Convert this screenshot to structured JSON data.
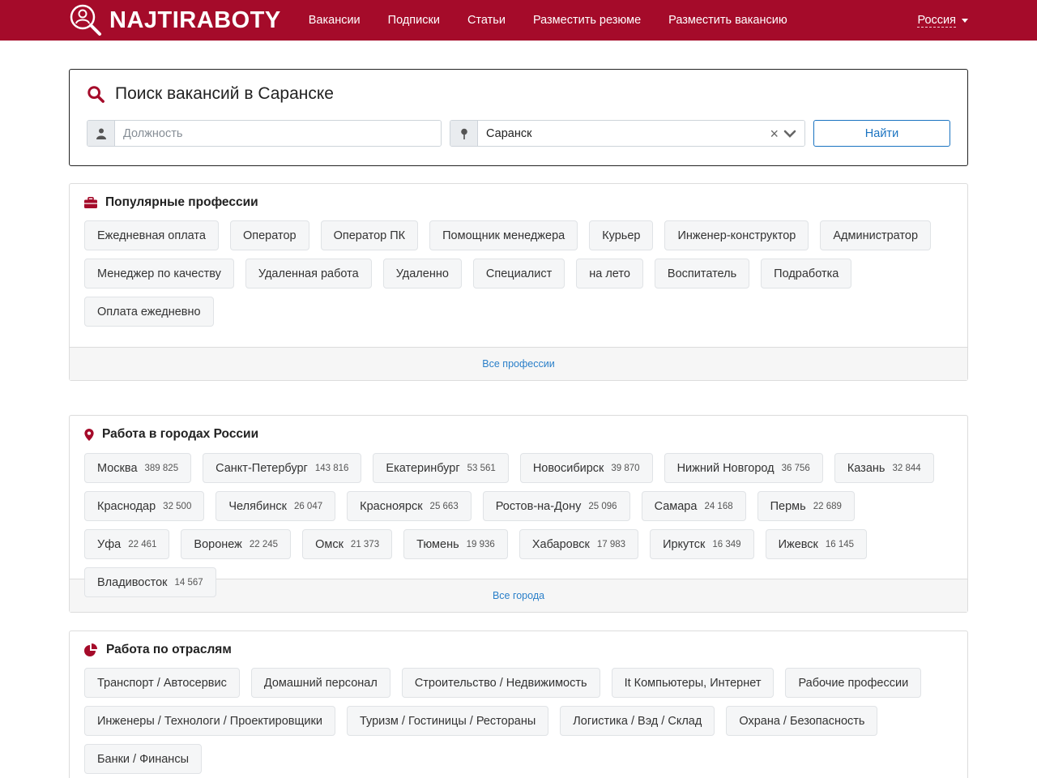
{
  "header": {
    "logo_text": "NAJTIRABOTY",
    "nav": [
      {
        "label": "Вакансии"
      },
      {
        "label": "Подписки"
      },
      {
        "label": "Статьи"
      },
      {
        "label": "Разместить резюме"
      },
      {
        "label": "Разместить вакансию"
      }
    ],
    "region": "Россия",
    "brand_color": "#a50b2a"
  },
  "search": {
    "title": "Поиск вакансий в Саранске",
    "position_placeholder": "Должность",
    "position_value": "",
    "city_value": "Саранск",
    "find_label": "Найти"
  },
  "professions": {
    "title": "Популярные профессии",
    "items": [
      {
        "label": "Ежедневная оплата"
      },
      {
        "label": "Оператор"
      },
      {
        "label": "Оператор ПК"
      },
      {
        "label": "Помощник менеджера"
      },
      {
        "label": "Курьер"
      },
      {
        "label": "Инженер-конструктор"
      },
      {
        "label": "Администратор"
      },
      {
        "label": "Менеджер по качеству"
      },
      {
        "label": "Удаленная работа"
      },
      {
        "label": "Удаленно"
      },
      {
        "label": "Специалист"
      },
      {
        "label": "на лето"
      },
      {
        "label": "Воспитатель"
      },
      {
        "label": "Подработка"
      },
      {
        "label": "Оплата ежедневно"
      }
    ],
    "footer_link": "Все профессии"
  },
  "cities": {
    "title": "Работа в городах России",
    "items": [
      {
        "label": "Москва",
        "count": "389 825"
      },
      {
        "label": "Санкт-Петербург",
        "count": "143 816"
      },
      {
        "label": "Екатеринбург",
        "count": "53 561"
      },
      {
        "label": "Новосибирск",
        "count": "39 870"
      },
      {
        "label": "Нижний Новгород",
        "count": "36 756"
      },
      {
        "label": "Казань",
        "count": "32 844"
      },
      {
        "label": "Краснодар",
        "count": "32 500"
      },
      {
        "label": "Челябинск",
        "count": "26 047"
      },
      {
        "label": "Красноярск",
        "count": "25 663"
      },
      {
        "label": "Ростов-на-Дону",
        "count": "25 096"
      },
      {
        "label": "Самара",
        "count": "24 168"
      },
      {
        "label": "Пермь",
        "count": "22 689"
      },
      {
        "label": "Уфа",
        "count": "22 461"
      },
      {
        "label": "Воронеж",
        "count": "22 245"
      },
      {
        "label": "Омск",
        "count": "21 373"
      },
      {
        "label": "Тюмень",
        "count": "19 936"
      },
      {
        "label": "Хабаровск",
        "count": "17 983"
      },
      {
        "label": "Иркутск",
        "count": "16 349"
      },
      {
        "label": "Ижевск",
        "count": "16 145"
      },
      {
        "label": "Владивосток",
        "count": "14 567"
      }
    ],
    "footer_link": "Все города"
  },
  "industries": {
    "title": "Работа по отраслям",
    "items": [
      {
        "label": "Транспорт / Автосервис"
      },
      {
        "label": "Домашний персонал"
      },
      {
        "label": "Строительство / Недвижимость"
      },
      {
        "label": "It Компьютеры, Интернет"
      },
      {
        "label": "Рабочие профессии"
      },
      {
        "label": "Инженеры / Технологи / Проектировщики"
      },
      {
        "label": "Туризм / Гостиницы / Рестораны"
      },
      {
        "label": "Логистика / Вэд / Склад"
      },
      {
        "label": "Охрана / Безопасность"
      },
      {
        "label": "Банки / Финансы"
      }
    ]
  }
}
